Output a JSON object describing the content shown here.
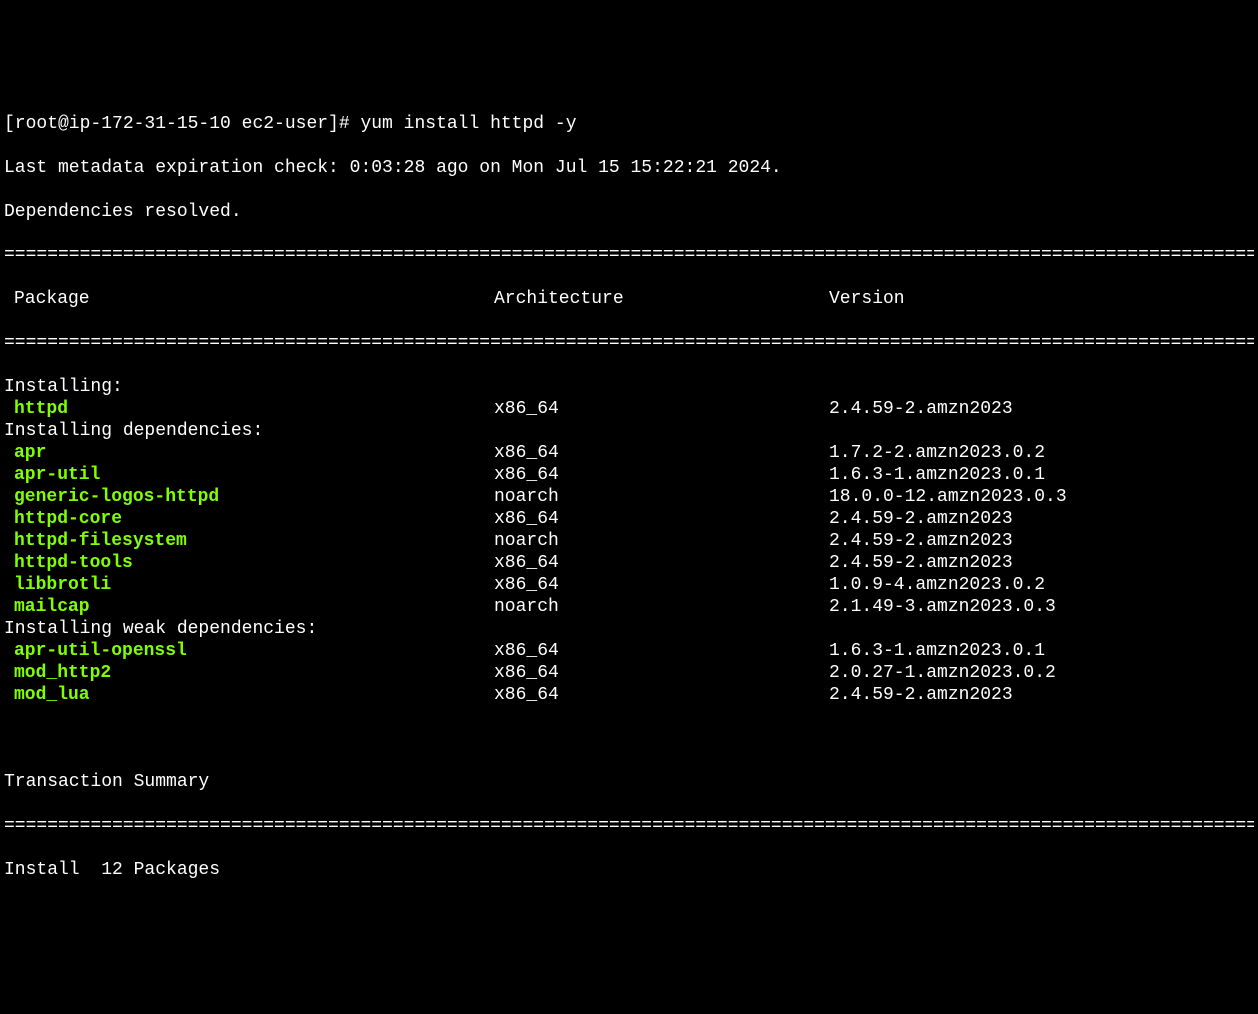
{
  "prompt": {
    "user": "[root@ip-172-31-15-10 ec2-user]#",
    "command": " yum install httpd -y"
  },
  "metadata_line": "Last metadata expiration check: 0:03:28 ago on Mon Jul 15 15:22:21 2024.",
  "deps_resolved": "Dependencies resolved.",
  "separator": "==============================================================================================================================================",
  "headers": {
    "package": "Package",
    "architecture": "Architecture",
    "version": "Version"
  },
  "sections": [
    {
      "label": "Installing:",
      "packages": [
        {
          "name": "httpd",
          "arch": "x86_64",
          "version": "2.4.59-2.amzn2023"
        }
      ]
    },
    {
      "label": "Installing dependencies:",
      "packages": [
        {
          "name": "apr",
          "arch": "x86_64",
          "version": "1.7.2-2.amzn2023.0.2"
        },
        {
          "name": "apr-util",
          "arch": "x86_64",
          "version": "1.6.3-1.amzn2023.0.1"
        },
        {
          "name": "generic-logos-httpd",
          "arch": "noarch",
          "version": "18.0.0-12.amzn2023.0.3"
        },
        {
          "name": "httpd-core",
          "arch": "x86_64",
          "version": "2.4.59-2.amzn2023"
        },
        {
          "name": "httpd-filesystem",
          "arch": "noarch",
          "version": "2.4.59-2.amzn2023"
        },
        {
          "name": "httpd-tools",
          "arch": "x86_64",
          "version": "2.4.59-2.amzn2023"
        },
        {
          "name": "libbrotli",
          "arch": "x86_64",
          "version": "1.0.9-4.amzn2023.0.2"
        },
        {
          "name": "mailcap",
          "arch": "noarch",
          "version": "2.1.49-3.amzn2023.0.3"
        }
      ]
    },
    {
      "label": "Installing weak dependencies:",
      "packages": [
        {
          "name": "apr-util-openssl",
          "arch": "x86_64",
          "version": "1.6.3-1.amzn2023.0.1"
        },
        {
          "name": "mod_http2",
          "arch": "x86_64",
          "version": "2.0.27-1.amzn2023.0.2"
        },
        {
          "name": "mod_lua",
          "arch": "x86_64",
          "version": "2.4.59-2.amzn2023"
        }
      ]
    }
  ],
  "transaction_summary": "Transaction Summary",
  "install_summary": "Install  12 Packages"
}
